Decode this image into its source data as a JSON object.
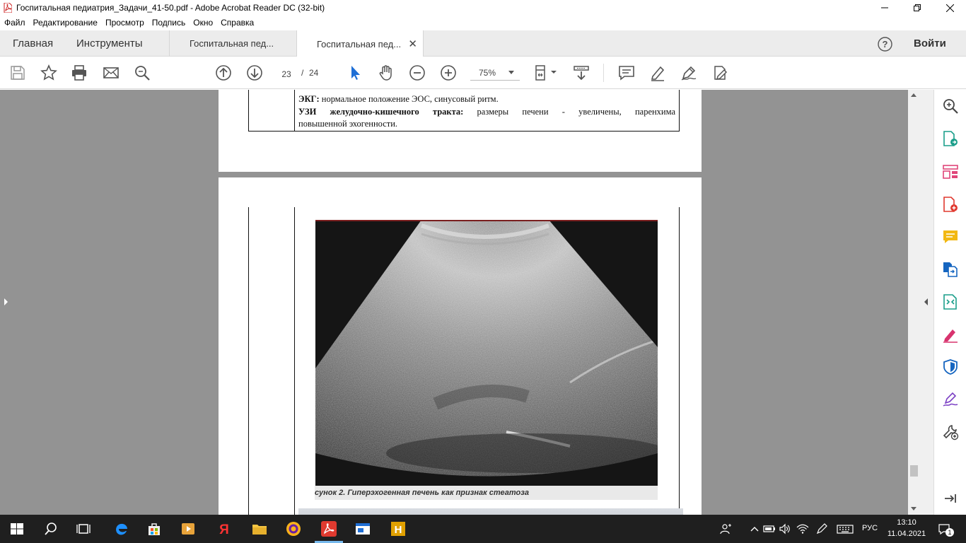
{
  "window": {
    "title": "Госпитальная педиатрия_Задачи_41-50.pdf - Adobe Acrobat Reader DC (32-bit)",
    "minimize_icon": "minimize-icon",
    "maximize_icon": "restore-icon",
    "close_icon": "close-icon"
  },
  "menu": [
    "Файл",
    "Редактирование",
    "Просмотр",
    "Подпись",
    "Окно",
    "Справка"
  ],
  "tabs": {
    "home": "Главная",
    "tools": "Инструменты",
    "docs": [
      {
        "label": "Госпитальная пед...",
        "active": false
      },
      {
        "label": "Госпитальная пед...",
        "active": true
      }
    ],
    "close_glyph": "✕",
    "sign_in": "Войти"
  },
  "toolbar": {
    "page_current": "23",
    "page_sep": "/",
    "page_total": "24",
    "zoom": "75%"
  },
  "document": {
    "page1": {
      "ekg_label": "ЭКГ:",
      "ekg_text": " нормальное положение ЭОС, синусовый ритм.",
      "us_label": "УЗИ желудочно-кишечного тракта:",
      "us_text_1": " размеры печени - увеличены, паренхима",
      "us_text_2": "повышенной эхогенности."
    },
    "page2": {
      "caption": "сунок 2. Гиперэхогенная печень как признак стеатоза"
    }
  },
  "taskbar": {
    "language": "РУС",
    "time": "13:10",
    "date": "11.04.2021",
    "notifications": "1",
    "colors": {
      "edge": "#1e90ff",
      "yandex": "#ff3333",
      "acrobat": "#e03a2f",
      "hotkeys": "#e0a000"
    }
  }
}
